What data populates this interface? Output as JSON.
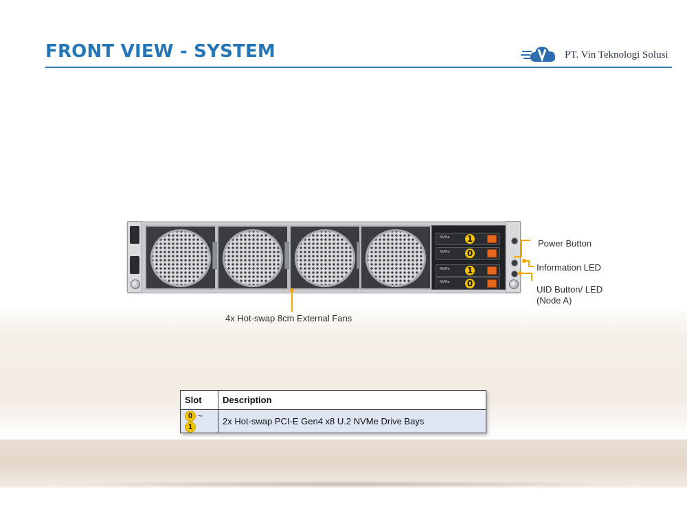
{
  "header": {
    "title": "FRONT VIEW - SYSTEM",
    "company_name": "PT. Vin Teknologi Solusi",
    "accent_color": "#2476b6"
  },
  "server": {
    "drive_slots": [
      "1",
      "0",
      "1",
      "0"
    ],
    "drive_tag": "NVMe"
  },
  "callouts": {
    "fans": "4x Hot-swap 8cm External Fans",
    "power_button": "Power Button",
    "information_led": "Information LED",
    "uid_button_line1": "UID Button/ LED",
    "uid_button_line2": "(Node A)",
    "callout_color": "#f2a900"
  },
  "table": {
    "headers": [
      "Slot",
      "Description"
    ],
    "rows": [
      {
        "slot_from": "0",
        "slot_sep": "~",
        "slot_to": "1",
        "description": "2x Hot-swap PCI-E Gen4 x8 U.2 NVMe Drive Bays"
      }
    ]
  }
}
